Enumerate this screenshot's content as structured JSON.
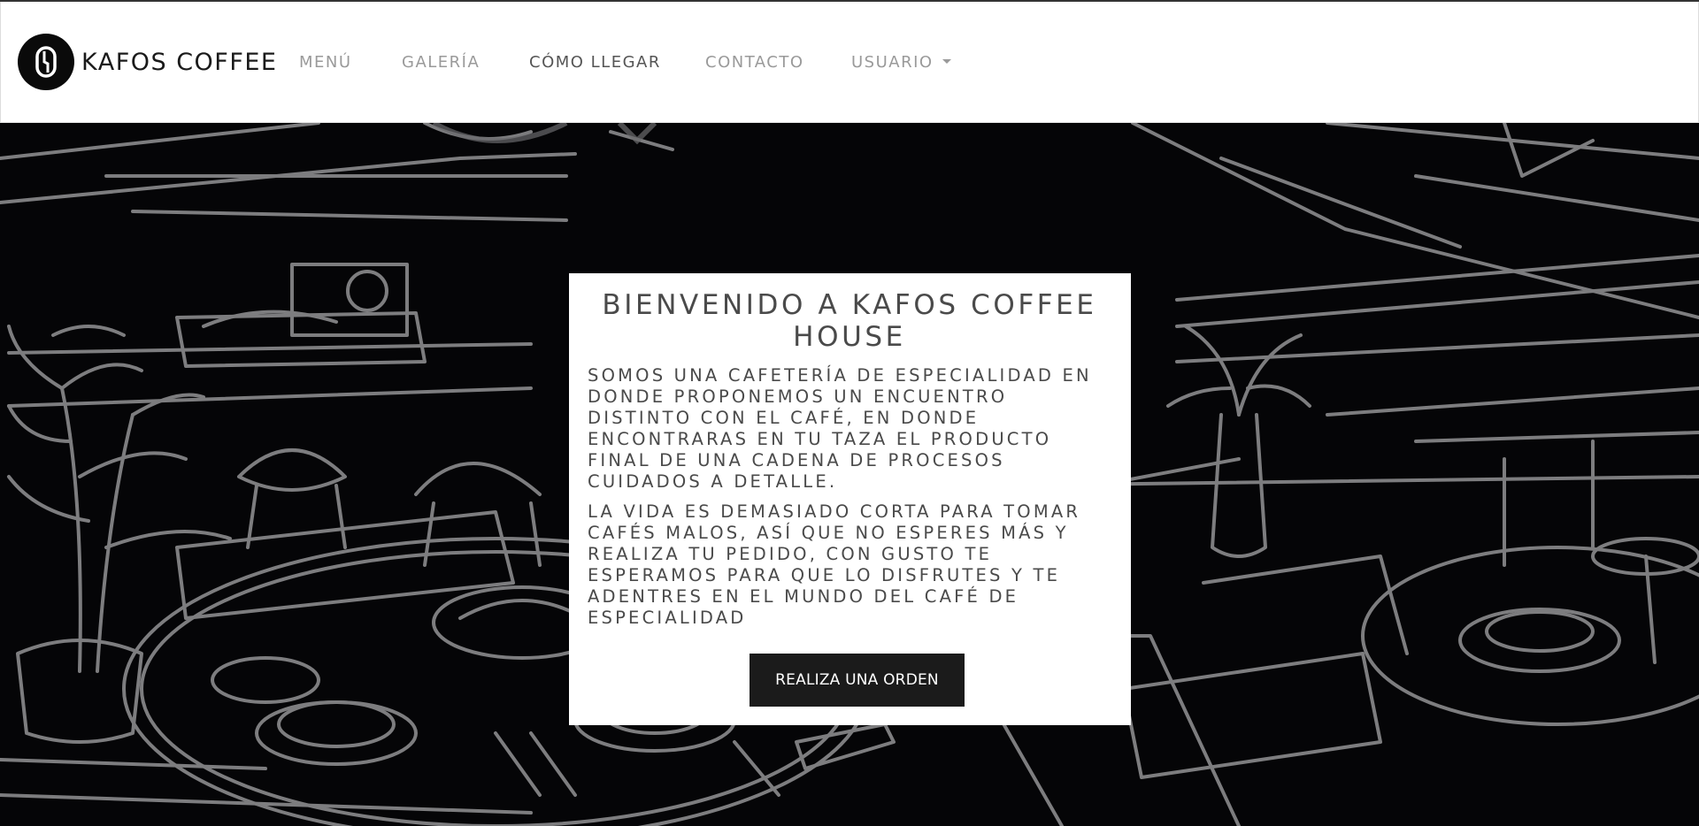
{
  "brand": {
    "name": "KAFOS COFFEE",
    "logo_icon": "coffee-bean-icon"
  },
  "nav": {
    "items": [
      {
        "label": "MENÚ",
        "active": false
      },
      {
        "label": "GALERÍA",
        "active": false
      },
      {
        "label": "CÓMO LLEGAR",
        "active": true
      },
      {
        "label": "CONTACTO",
        "active": false
      },
      {
        "label": "USUARIO",
        "active": false,
        "dropdown": true
      }
    ]
  },
  "hero": {
    "title": "BIENVENIDO A KAFOS COFFEE HOUSE",
    "paragraphs": [
      "SOMOS UNA CAFETERÍA DE ESPECIALIDAD EN DONDE PROPONEMOS UN ENCUENTRO DISTINTO CON EL CAFÉ, EN DONDE ENCONTRARAS EN TU TAZA EL PRODUCTO FINAL DE UNA CADENA DE PROCESOS CUIDADOS A DETALLE.",
      "LA VIDA ES DEMASIADO CORTA PARA TOMAR CAFÉS MALOS, ASÍ QUE NO ESPERES MÁS Y REALIZA TU PEDIDO, CON GUSTO TE ESPERAMOS PARA QUE LO DISFRUTES Y TE ADENTRES EN EL MUNDO DEL CAFÉ DE ESPECIALIDAD"
    ],
    "cta_label": "REALIZA UNA ORDEN"
  },
  "colors": {
    "navbar_bg": "#ffffff",
    "hero_bg": "#050507",
    "line_art": "#8a8a8c",
    "button_bg": "#1b1b1b",
    "text_dark": "#4a4a4a",
    "nav_text": "#9a9a9a"
  }
}
